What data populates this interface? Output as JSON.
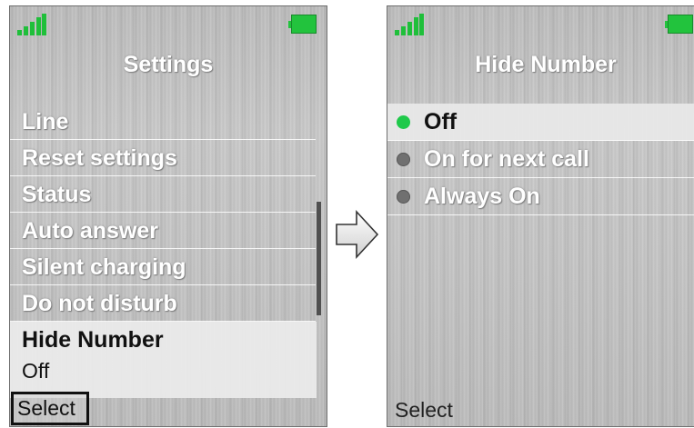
{
  "left_screen": {
    "title": "Settings",
    "menu_items": [
      "Line",
      "Reset settings",
      "Status",
      "Auto answer",
      "Silent charging",
      "Do not disturb"
    ],
    "selected_item": {
      "label": "Hide Number",
      "value": "Off"
    },
    "softkey_label": "Select"
  },
  "right_screen": {
    "title": "Hide Number",
    "options": [
      {
        "label": "Off",
        "selected": true
      },
      {
        "label": "On for next call",
        "selected": false
      },
      {
        "label": "Always On",
        "selected": false
      }
    ],
    "softkey_label": "Select"
  },
  "colors": {
    "signal": "#1fbf3a",
    "battery": "#22c33d",
    "radio_selected": "#1fc94a",
    "radio_unselected": "#707070"
  },
  "icons": [
    "signal-strength-icon",
    "battery-icon",
    "right-arrow-icon",
    "radio-icon"
  ]
}
